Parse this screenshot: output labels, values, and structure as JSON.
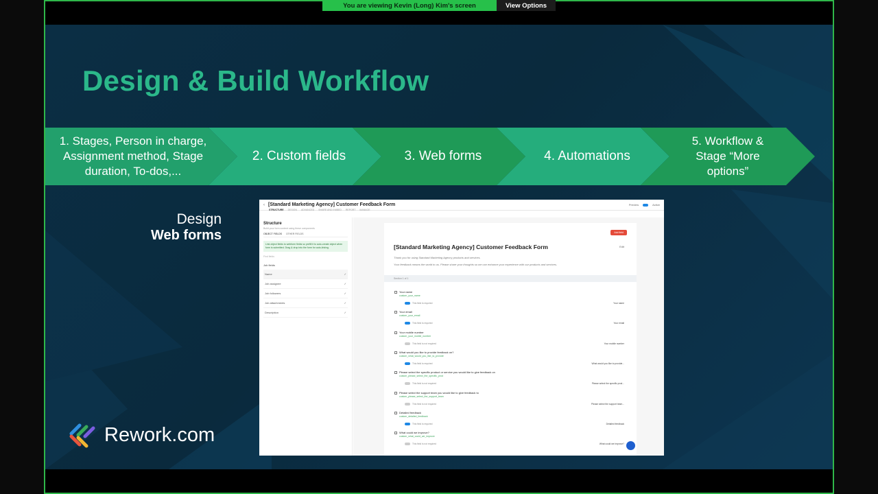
{
  "banner": {
    "message": "You are viewing  Kevin (Long) Kim's screen",
    "view_options": "View Options"
  },
  "slide": {
    "title": "Design & Build Workflow",
    "steps": [
      {
        "lines": [
          "1. Stages, Person in charge,",
          "Assignment method, Stage",
          "duration, To-dos,..."
        ]
      },
      {
        "lines": [
          "2. Custom fields"
        ]
      },
      {
        "lines": [
          "3. Web forms"
        ]
      },
      {
        "lines": [
          "4. Automations"
        ]
      },
      {
        "lines": [
          "5. Workflow &",
          "Stage “More",
          "options”"
        ]
      }
    ],
    "design_label": {
      "line1": "Design",
      "line2": "Web forms"
    },
    "logo_text": "Rework.com",
    "colors": {
      "title": "#2bb88a",
      "chevron_light": "#26a87a",
      "chevron_dark": "#1f9a57",
      "background": "#0b2e44"
    }
  },
  "screenshot": {
    "header_title": "[Standard Marketing Agency] Customer Feedback Form",
    "tabs": [
      "STRUCTURE",
      "DESIGN",
      "ADVANCED",
      "SHARE AND EMBED",
      "REPORT",
      "MANAGE"
    ],
    "preview": "Preview",
    "active": "Active",
    "left": {
      "title": "Structure",
      "subtitle": "Build your form content using these components",
      "tab_object": "OBJECT FIELDS",
      "tab_other": "OTHER FIELDS",
      "tip": "Link object fields to webform fields so prefill it to auto-create object when form is submitted. Drag & drop into the form for auto-linking.",
      "search": "Find fields",
      "group": "Job fields",
      "fields": [
        "Name",
        "Job assignee",
        "Job followers",
        "Job attachments",
        "Description"
      ]
    },
    "form": {
      "add_field": "Add field",
      "edit": "Edit",
      "title": "[Standard Marketing Agency] Customer Feedback Form",
      "desc1": "Thank you for using Standard Marketing Agency products and services.",
      "desc2": "Your feedback means the world to us. Please share your thoughts so we can enhance your experience with our products and services.",
      "section": "Section 1 of 1",
      "fields": [
        {
          "name": "Your name",
          "key": "custom_your_name",
          "req": "This field is required",
          "link": "Your name",
          "on": true
        },
        {
          "name": "Your email",
          "key": "custom_your_email",
          "req": "This field is required",
          "link": "Your email",
          "on": true
        },
        {
          "name": "Your mobile number",
          "key": "custom_your_mobile_number",
          "req": "This field is not required",
          "link": "Your mobile number",
          "on": false
        },
        {
          "name": "What would you like to provide feedback on?",
          "key": "custom_what_would_you_like_to_provide",
          "req": "This field is required",
          "link": "What would you like to provide...",
          "on": true
        },
        {
          "name": "Please select the specific product or service you would like to give feedback on",
          "key": "custom_please_select_the_specific_prod",
          "req": "This field is not required",
          "link": "Please select the specific prod...",
          "on": false
        },
        {
          "name": "Please select the support team you would like to give feedback to",
          "key": "custom_please_select_the_support_team",
          "req": "This field is not required",
          "link": "Please select the support team...",
          "on": false
        },
        {
          "name": "Detailed feedback",
          "key": "custom_detailed_feedback",
          "req": "This field is required",
          "link": "Detailed feedback",
          "on": true
        },
        {
          "name": "What could we improve?",
          "key": "custom_what_could_we_improve",
          "req": "This field is not required",
          "link": "What could we improve?",
          "on": false
        }
      ]
    }
  }
}
